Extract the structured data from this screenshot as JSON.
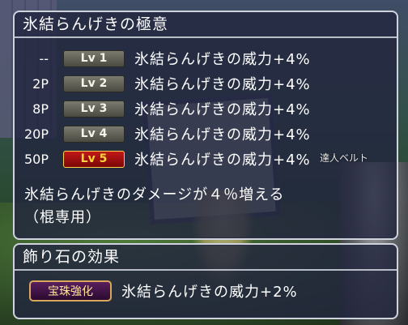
{
  "skill_panel": {
    "title": "氷結らんげきの極意",
    "rows": [
      {
        "cost": "--",
        "level": "Lv 1",
        "effect": "氷結らんげきの威力+4%",
        "active": false
      },
      {
        "cost": "2P",
        "level": "Lv 2",
        "effect": "氷結らんげきの威力+4%",
        "active": false
      },
      {
        "cost": "8P",
        "level": "Lv 3",
        "effect": "氷結らんげきの威力+4%",
        "active": false
      },
      {
        "cost": "20P",
        "level": "Lv 4",
        "effect": "氷結らんげきの威力+4%",
        "active": false
      },
      {
        "cost": "50P",
        "level": "Lv 5",
        "effect": "氷結らんげきの威力+4%",
        "active": true
      }
    ],
    "description_line1": "氷結らんげきのダメージが４％増える",
    "description_line2": "（棍専用）"
  },
  "npc_name": "達人ベルト",
  "stone_panel": {
    "title": "飾り石の効果",
    "badge": "宝珠強化",
    "effect": "氷結らんげきの威力+2%"
  },
  "colors": {
    "panel_bg": "#22263e",
    "active_level_bg": "#c21818",
    "active_level_text": "#ffd43c",
    "badge_bg": "#5a1f5e"
  }
}
